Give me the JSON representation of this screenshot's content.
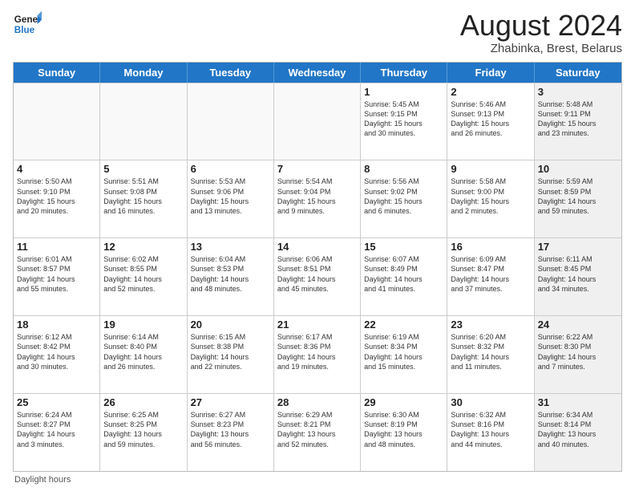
{
  "logo": {
    "line1": "General",
    "line2": "Blue"
  },
  "title": "August 2024",
  "subtitle": "Zhabinka, Brest, Belarus",
  "days_of_week": [
    "Sunday",
    "Monday",
    "Tuesday",
    "Wednesday",
    "Thursday",
    "Friday",
    "Saturday"
  ],
  "footnote": "Daylight hours",
  "rows": [
    [
      {
        "day": "",
        "text": "",
        "empty": true
      },
      {
        "day": "",
        "text": "",
        "empty": true
      },
      {
        "day": "",
        "text": "",
        "empty": true
      },
      {
        "day": "",
        "text": "",
        "empty": true
      },
      {
        "day": "1",
        "text": "Sunrise: 5:45 AM\nSunset: 9:15 PM\nDaylight: 15 hours\nand 30 minutes."
      },
      {
        "day": "2",
        "text": "Sunrise: 5:46 AM\nSunset: 9:13 PM\nDaylight: 15 hours\nand 26 minutes."
      },
      {
        "day": "3",
        "text": "Sunrise: 5:48 AM\nSunset: 9:11 PM\nDaylight: 15 hours\nand 23 minutes.",
        "shaded": true
      }
    ],
    [
      {
        "day": "4",
        "text": "Sunrise: 5:50 AM\nSunset: 9:10 PM\nDaylight: 15 hours\nand 20 minutes."
      },
      {
        "day": "5",
        "text": "Sunrise: 5:51 AM\nSunset: 9:08 PM\nDaylight: 15 hours\nand 16 minutes."
      },
      {
        "day": "6",
        "text": "Sunrise: 5:53 AM\nSunset: 9:06 PM\nDaylight: 15 hours\nand 13 minutes."
      },
      {
        "day": "7",
        "text": "Sunrise: 5:54 AM\nSunset: 9:04 PM\nDaylight: 15 hours\nand 9 minutes."
      },
      {
        "day": "8",
        "text": "Sunrise: 5:56 AM\nSunset: 9:02 PM\nDaylight: 15 hours\nand 6 minutes."
      },
      {
        "day": "9",
        "text": "Sunrise: 5:58 AM\nSunset: 9:00 PM\nDaylight: 15 hours\nand 2 minutes."
      },
      {
        "day": "10",
        "text": "Sunrise: 5:59 AM\nSunset: 8:59 PM\nDaylight: 14 hours\nand 59 minutes.",
        "shaded": true
      }
    ],
    [
      {
        "day": "11",
        "text": "Sunrise: 6:01 AM\nSunset: 8:57 PM\nDaylight: 14 hours\nand 55 minutes."
      },
      {
        "day": "12",
        "text": "Sunrise: 6:02 AM\nSunset: 8:55 PM\nDaylight: 14 hours\nand 52 minutes."
      },
      {
        "day": "13",
        "text": "Sunrise: 6:04 AM\nSunset: 8:53 PM\nDaylight: 14 hours\nand 48 minutes."
      },
      {
        "day": "14",
        "text": "Sunrise: 6:06 AM\nSunset: 8:51 PM\nDaylight: 14 hours\nand 45 minutes."
      },
      {
        "day": "15",
        "text": "Sunrise: 6:07 AM\nSunset: 8:49 PM\nDaylight: 14 hours\nand 41 minutes."
      },
      {
        "day": "16",
        "text": "Sunrise: 6:09 AM\nSunset: 8:47 PM\nDaylight: 14 hours\nand 37 minutes."
      },
      {
        "day": "17",
        "text": "Sunrise: 6:11 AM\nSunset: 8:45 PM\nDaylight: 14 hours\nand 34 minutes.",
        "shaded": true
      }
    ],
    [
      {
        "day": "18",
        "text": "Sunrise: 6:12 AM\nSunset: 8:42 PM\nDaylight: 14 hours\nand 30 minutes."
      },
      {
        "day": "19",
        "text": "Sunrise: 6:14 AM\nSunset: 8:40 PM\nDaylight: 14 hours\nand 26 minutes."
      },
      {
        "day": "20",
        "text": "Sunrise: 6:15 AM\nSunset: 8:38 PM\nDaylight: 14 hours\nand 22 minutes."
      },
      {
        "day": "21",
        "text": "Sunrise: 6:17 AM\nSunset: 8:36 PM\nDaylight: 14 hours\nand 19 minutes."
      },
      {
        "day": "22",
        "text": "Sunrise: 6:19 AM\nSunset: 8:34 PM\nDaylight: 14 hours\nand 15 minutes."
      },
      {
        "day": "23",
        "text": "Sunrise: 6:20 AM\nSunset: 8:32 PM\nDaylight: 14 hours\nand 11 minutes."
      },
      {
        "day": "24",
        "text": "Sunrise: 6:22 AM\nSunset: 8:30 PM\nDaylight: 14 hours\nand 7 minutes.",
        "shaded": true
      }
    ],
    [
      {
        "day": "25",
        "text": "Sunrise: 6:24 AM\nSunset: 8:27 PM\nDaylight: 14 hours\nand 3 minutes."
      },
      {
        "day": "26",
        "text": "Sunrise: 6:25 AM\nSunset: 8:25 PM\nDaylight: 13 hours\nand 59 minutes."
      },
      {
        "day": "27",
        "text": "Sunrise: 6:27 AM\nSunset: 8:23 PM\nDaylight: 13 hours\nand 56 minutes."
      },
      {
        "day": "28",
        "text": "Sunrise: 6:29 AM\nSunset: 8:21 PM\nDaylight: 13 hours\nand 52 minutes."
      },
      {
        "day": "29",
        "text": "Sunrise: 6:30 AM\nSunset: 8:19 PM\nDaylight: 13 hours\nand 48 minutes."
      },
      {
        "day": "30",
        "text": "Sunrise: 6:32 AM\nSunset: 8:16 PM\nDaylight: 13 hours\nand 44 minutes."
      },
      {
        "day": "31",
        "text": "Sunrise: 6:34 AM\nSunset: 8:14 PM\nDaylight: 13 hours\nand 40 minutes.",
        "shaded": true
      }
    ]
  ]
}
